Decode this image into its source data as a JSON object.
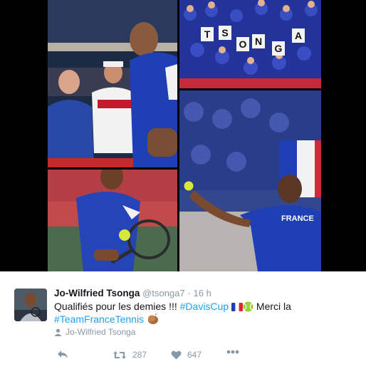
{
  "media": {
    "crowd_sign_letters": [
      "T",
      "S",
      "O",
      "N",
      "G",
      "A"
    ],
    "jersey_text": "FRANCE"
  },
  "tweet": {
    "name": "Jo-Wilfried Tsonga",
    "handle": "@tsonga7",
    "separator": "·",
    "time": "16 h",
    "text_part1": "Qualifiés pour les demies !!! ",
    "hashtag1": "#DavisCup",
    "text_part2": " Merci la",
    "hashtag2": "#TeamFranceTennis",
    "attribution": "Jo-Wilfried Tsonga",
    "retweets": "287",
    "likes": "647"
  },
  "icons": {
    "flag": "france-flag-icon",
    "emoji_ball": "tennis-ball-icon",
    "emoji_hands": "clapping-hands-icon",
    "attribution": "person-icon",
    "reply": "reply-icon",
    "retweet": "retweet-icon",
    "like": "heart-icon",
    "more": "more-icon"
  },
  "colors": {
    "link": "#1da1f2",
    "meta": "#8899a6",
    "text": "#14171a",
    "team_blue": "#1f3fb5"
  }
}
